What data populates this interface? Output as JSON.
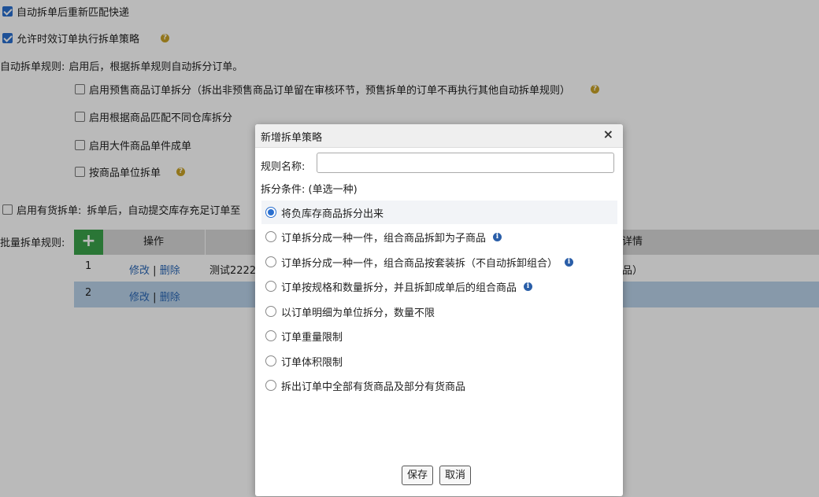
{
  "background": {
    "checkbox_rematch": {
      "label": "自动拆单后重新匹配快递",
      "checked": true
    },
    "checkbox_timely": {
      "label": "允许时效订单执行拆单策略",
      "checked": true
    },
    "auto_rule_label": "自动拆单规则:",
    "auto_rule_desc": "启用后，根据拆单规则自动拆分订单。",
    "auto_rules": [
      {
        "label": "启用预售商品订单拆分（拆出非预售商品订单留在审核环节，预售拆单的订单不再执行其他自动拆单规则）",
        "checked": false
      },
      {
        "label": "启用根据商品匹配不同仓库拆分",
        "checked": false
      },
      {
        "label": "启用大件商品单件成单",
        "checked": false
      },
      {
        "label": "按商品单位拆单",
        "checked": false
      }
    ],
    "stock_split": {
      "label": "启用有货拆单:",
      "desc": "拆单后，自动提交库存充足订单至",
      "checked": false
    },
    "batch_label": "批量拆单规则:",
    "table": {
      "add_icon": "+",
      "col_op": "操作",
      "col_detail": "详情",
      "rows": [
        {
          "no": "1",
          "edit": "修改",
          "sep": "|",
          "del": "删除",
          "name": "测试2222",
          "detail": "品）"
        },
        {
          "no": "2",
          "edit": "修改",
          "sep": "|",
          "del": "删除",
          "name": "",
          "detail": ""
        }
      ]
    }
  },
  "dialog": {
    "title": "新增拆单策略",
    "close": "×",
    "rule_name_label": "规则名称:",
    "rule_name_value": "",
    "condition_label": "拆分条件: (单选一种)",
    "options": [
      {
        "label": "将负库存商品拆分出来",
        "selected": true,
        "info": false
      },
      {
        "label": "订单拆分成一种一件，组合商品拆卸为子商品",
        "selected": false,
        "info": true
      },
      {
        "label": "订单拆分成一种一件，组合商品按套装拆（不自动拆卸组合）",
        "selected": false,
        "info": true
      },
      {
        "label": "订单按规格和数量拆分，并且拆卸成单后的组合商品",
        "selected": false,
        "info": true
      },
      {
        "label": "以订单明细为单位拆分，数量不限",
        "selected": false,
        "info": false
      },
      {
        "label": "订单重量限制",
        "selected": false,
        "info": false
      },
      {
        "label": "订单体积限制",
        "selected": false,
        "info": false
      },
      {
        "label": "拆出订单中全部有货商品及部分有货商品",
        "selected": false,
        "info": false
      }
    ],
    "save_label": "保存",
    "cancel_label": "取消"
  },
  "colors": {
    "accent": "#2a6fcf",
    "add_button": "#3aa24a",
    "selected_row": "#b9d2ea",
    "help_icon": "#c9a227",
    "info_icon": "#2a5ea8"
  }
}
